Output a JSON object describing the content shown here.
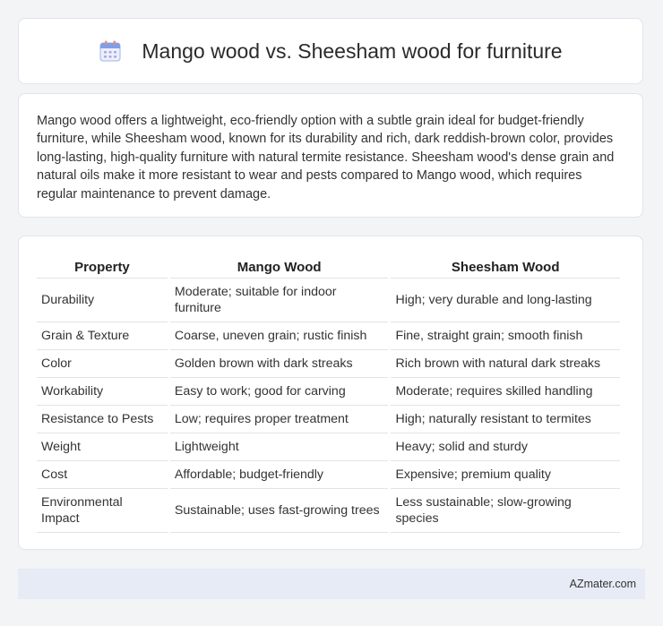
{
  "header": {
    "icon": "calendar-icon",
    "title": "Mango wood vs. Sheesham wood for furniture"
  },
  "summary": {
    "text": "Mango wood offers a lightweight, eco-friendly option with a subtle grain ideal for budget-friendly furniture, while Sheesham wood, known for its durability and rich, dark reddish-brown color, provides long-lasting, high-quality furniture with natural termite resistance. Sheesham wood's dense grain and natural oils make it more resistant to wear and pests compared to Mango wood, which requires regular maintenance to prevent damage."
  },
  "table": {
    "headers": [
      "Property",
      "Mango Wood",
      "Sheesham Wood"
    ],
    "rows": [
      [
        "Durability",
        "Moderate; suitable for indoor furniture",
        "High; very durable and long-lasting"
      ],
      [
        "Grain & Texture",
        "Coarse, uneven grain; rustic finish",
        "Fine, straight grain; smooth finish"
      ],
      [
        "Color",
        "Golden brown with dark streaks",
        "Rich brown with natural dark streaks"
      ],
      [
        "Workability",
        "Easy to work; good for carving",
        "Moderate; requires skilled handling"
      ],
      [
        "Resistance to Pests",
        "Low; requires proper treatment",
        "High; naturally resistant to termites"
      ],
      [
        "Weight",
        "Lightweight",
        "Heavy; solid and sturdy"
      ],
      [
        "Cost",
        "Affordable; budget-friendly",
        "Expensive; premium quality"
      ],
      [
        "Environmental Impact",
        "Sustainable; uses fast-growing trees",
        "Less sustainable; slow-growing species"
      ]
    ]
  },
  "footer": {
    "site": "AZmater.com"
  },
  "colors": {
    "background": "#f3f4f6",
    "card": "#ffffff",
    "footer_bg": "#e6ebf6",
    "icon_accent": "#6d8fe0"
  }
}
